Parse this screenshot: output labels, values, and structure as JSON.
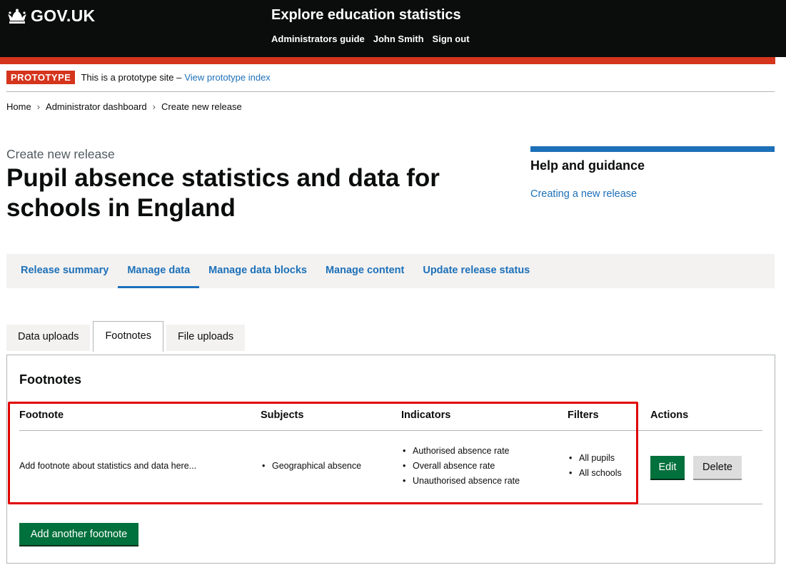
{
  "header": {
    "logo_text": "GOV.UK",
    "service_name": "Explore education statistics",
    "nav": [
      "Administrators guide",
      "John Smith",
      "Sign out"
    ]
  },
  "prototype": {
    "tag": "PROTOTYPE",
    "text": "This is a prototype site –",
    "link": "View prototype index"
  },
  "breadcrumbs": [
    "Home",
    "Administrator dashboard",
    "Create new release"
  ],
  "page": {
    "caption": "Create new release",
    "title": "Pupil absence statistics and data for schools in England"
  },
  "guidance": {
    "title": "Help and guidance",
    "link": "Creating a new release"
  },
  "main_nav": {
    "items": [
      "Release summary",
      "Manage data",
      "Manage data blocks",
      "Manage content",
      "Update release status"
    ],
    "active": "Manage data"
  },
  "tabs": {
    "items": [
      "Data uploads",
      "Footnotes",
      "File uploads"
    ],
    "selected": "Footnotes"
  },
  "footnotes": {
    "title": "Footnotes",
    "headers": [
      "Footnote",
      "Subjects",
      "Indicators",
      "Filters",
      "Actions"
    ],
    "row": {
      "footnote": "Add footnote about statistics and data here...",
      "subjects": [
        "Geographical absence"
      ],
      "indicators": [
        "Authorised absence rate",
        "Overall absence rate",
        "Unauthorised absence rate"
      ],
      "filters": [
        "All pupils",
        "All schools"
      ],
      "edit_label": "Edit",
      "delete_label": "Delete"
    },
    "add_label": "Add another footnote"
  },
  "colors": {
    "header_bg": "#0b0c0c",
    "accent_red": "#d4351c",
    "link_blue": "#1d70b8",
    "button_green": "#00703c",
    "highlight_red": "#e00000"
  }
}
